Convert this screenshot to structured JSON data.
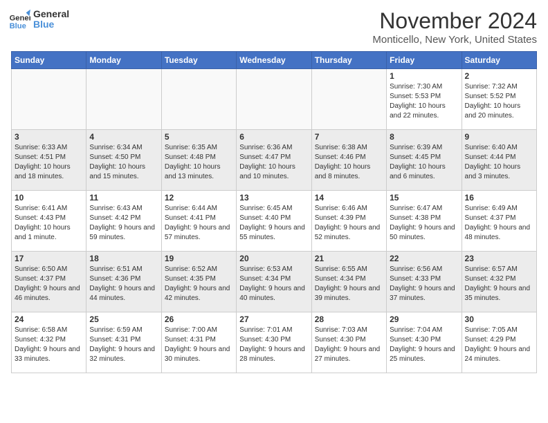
{
  "header": {
    "logo_text_general": "General",
    "logo_text_blue": "Blue",
    "month_title": "November 2024",
    "location": "Monticello, New York, United States"
  },
  "calendar": {
    "headers": [
      "Sunday",
      "Monday",
      "Tuesday",
      "Wednesday",
      "Thursday",
      "Friday",
      "Saturday"
    ],
    "weeks": [
      [
        {
          "day": "",
          "info": ""
        },
        {
          "day": "",
          "info": ""
        },
        {
          "day": "",
          "info": ""
        },
        {
          "day": "",
          "info": ""
        },
        {
          "day": "",
          "info": ""
        },
        {
          "day": "1",
          "info": "Sunrise: 7:30 AM\nSunset: 5:53 PM\nDaylight: 10 hours and 22 minutes."
        },
        {
          "day": "2",
          "info": "Sunrise: 7:32 AM\nSunset: 5:52 PM\nDaylight: 10 hours and 20 minutes."
        }
      ],
      [
        {
          "day": "3",
          "info": "Sunrise: 6:33 AM\nSunset: 4:51 PM\nDaylight: 10 hours and 18 minutes."
        },
        {
          "day": "4",
          "info": "Sunrise: 6:34 AM\nSunset: 4:50 PM\nDaylight: 10 hours and 15 minutes."
        },
        {
          "day": "5",
          "info": "Sunrise: 6:35 AM\nSunset: 4:48 PM\nDaylight: 10 hours and 13 minutes."
        },
        {
          "day": "6",
          "info": "Sunrise: 6:36 AM\nSunset: 4:47 PM\nDaylight: 10 hours and 10 minutes."
        },
        {
          "day": "7",
          "info": "Sunrise: 6:38 AM\nSunset: 4:46 PM\nDaylight: 10 hours and 8 minutes."
        },
        {
          "day": "8",
          "info": "Sunrise: 6:39 AM\nSunset: 4:45 PM\nDaylight: 10 hours and 6 minutes."
        },
        {
          "day": "9",
          "info": "Sunrise: 6:40 AM\nSunset: 4:44 PM\nDaylight: 10 hours and 3 minutes."
        }
      ],
      [
        {
          "day": "10",
          "info": "Sunrise: 6:41 AM\nSunset: 4:43 PM\nDaylight: 10 hours and 1 minute."
        },
        {
          "day": "11",
          "info": "Sunrise: 6:43 AM\nSunset: 4:42 PM\nDaylight: 9 hours and 59 minutes."
        },
        {
          "day": "12",
          "info": "Sunrise: 6:44 AM\nSunset: 4:41 PM\nDaylight: 9 hours and 57 minutes."
        },
        {
          "day": "13",
          "info": "Sunrise: 6:45 AM\nSunset: 4:40 PM\nDaylight: 9 hours and 55 minutes."
        },
        {
          "day": "14",
          "info": "Sunrise: 6:46 AM\nSunset: 4:39 PM\nDaylight: 9 hours and 52 minutes."
        },
        {
          "day": "15",
          "info": "Sunrise: 6:47 AM\nSunset: 4:38 PM\nDaylight: 9 hours and 50 minutes."
        },
        {
          "day": "16",
          "info": "Sunrise: 6:49 AM\nSunset: 4:37 PM\nDaylight: 9 hours and 48 minutes."
        }
      ],
      [
        {
          "day": "17",
          "info": "Sunrise: 6:50 AM\nSunset: 4:37 PM\nDaylight: 9 hours and 46 minutes."
        },
        {
          "day": "18",
          "info": "Sunrise: 6:51 AM\nSunset: 4:36 PM\nDaylight: 9 hours and 44 minutes."
        },
        {
          "day": "19",
          "info": "Sunrise: 6:52 AM\nSunset: 4:35 PM\nDaylight: 9 hours and 42 minutes."
        },
        {
          "day": "20",
          "info": "Sunrise: 6:53 AM\nSunset: 4:34 PM\nDaylight: 9 hours and 40 minutes."
        },
        {
          "day": "21",
          "info": "Sunrise: 6:55 AM\nSunset: 4:34 PM\nDaylight: 9 hours and 39 minutes."
        },
        {
          "day": "22",
          "info": "Sunrise: 6:56 AM\nSunset: 4:33 PM\nDaylight: 9 hours and 37 minutes."
        },
        {
          "day": "23",
          "info": "Sunrise: 6:57 AM\nSunset: 4:32 PM\nDaylight: 9 hours and 35 minutes."
        }
      ],
      [
        {
          "day": "24",
          "info": "Sunrise: 6:58 AM\nSunset: 4:32 PM\nDaylight: 9 hours and 33 minutes."
        },
        {
          "day": "25",
          "info": "Sunrise: 6:59 AM\nSunset: 4:31 PM\nDaylight: 9 hours and 32 minutes."
        },
        {
          "day": "26",
          "info": "Sunrise: 7:00 AM\nSunset: 4:31 PM\nDaylight: 9 hours and 30 minutes."
        },
        {
          "day": "27",
          "info": "Sunrise: 7:01 AM\nSunset: 4:30 PM\nDaylight: 9 hours and 28 minutes."
        },
        {
          "day": "28",
          "info": "Sunrise: 7:03 AM\nSunset: 4:30 PM\nDaylight: 9 hours and 27 minutes."
        },
        {
          "day": "29",
          "info": "Sunrise: 7:04 AM\nSunset: 4:30 PM\nDaylight: 9 hours and 25 minutes."
        },
        {
          "day": "30",
          "info": "Sunrise: 7:05 AM\nSunset: 4:29 PM\nDaylight: 9 hours and 24 minutes."
        }
      ]
    ]
  }
}
